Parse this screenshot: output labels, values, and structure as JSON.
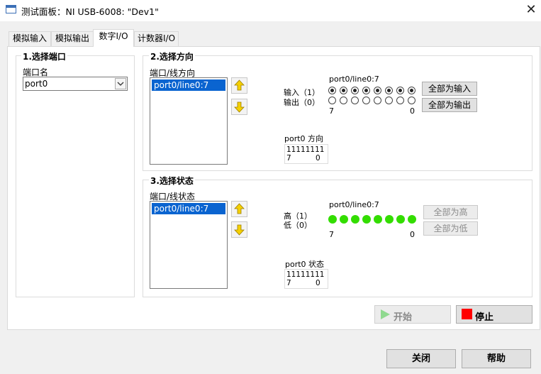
{
  "window": {
    "title": "测试面板：NI USB-6008: \"Dev1\"",
    "close_glyph": "✕"
  },
  "tabs": [
    {
      "label": "模拟输入"
    },
    {
      "label": "模拟输出"
    },
    {
      "label": "数字I/O"
    },
    {
      "label": "计数器I/O"
    }
  ],
  "port_group": {
    "title": "1.选择端口",
    "port_name_label": "端口名",
    "port_value": "port0"
  },
  "direction_group": {
    "title": "2.选择方向",
    "list_label": "端口/线方向",
    "list_items": [
      "port0/line0:7"
    ],
    "line_range_label": "port0/line0:7",
    "input_label": "输入（1）",
    "output_label": "输出（0）",
    "bit_high_label": "7",
    "bit_low_label": "0",
    "radio_states": [
      1,
      1,
      1,
      1,
      1,
      1,
      1,
      1
    ],
    "all_input_button": "全部为输入",
    "all_output_button": "全部为输出",
    "summary_label": "port0 方向",
    "summary_value": "11111111",
    "summary_high": "7",
    "summary_low": "0"
  },
  "state_group": {
    "title": "3.选择状态",
    "list_label": "端口/线状态",
    "list_items": [
      "port0/line0:7"
    ],
    "line_range_label": "port0/line0:7",
    "high_label": "高（1）",
    "low_label": "低（0）",
    "bit_high_label": "7",
    "bit_low_label": "0",
    "led_states": [
      1,
      1,
      1,
      1,
      1,
      1,
      1,
      1
    ],
    "all_high_button": "全部为高",
    "all_low_button": "全部为低",
    "summary_label": "port0 状态",
    "summary_value": "11111111",
    "summary_high": "7",
    "summary_low": "0"
  },
  "actions": {
    "start_label": "开始",
    "stop_label": "停止",
    "close_label": "关闭",
    "help_label": "帮助"
  },
  "colors": {
    "selection": "#0a64d0",
    "led_on": "#33dd00",
    "stop_red": "#ff0000",
    "start_green": "#8fd98f",
    "arrow_yellow": "#f5d000"
  }
}
